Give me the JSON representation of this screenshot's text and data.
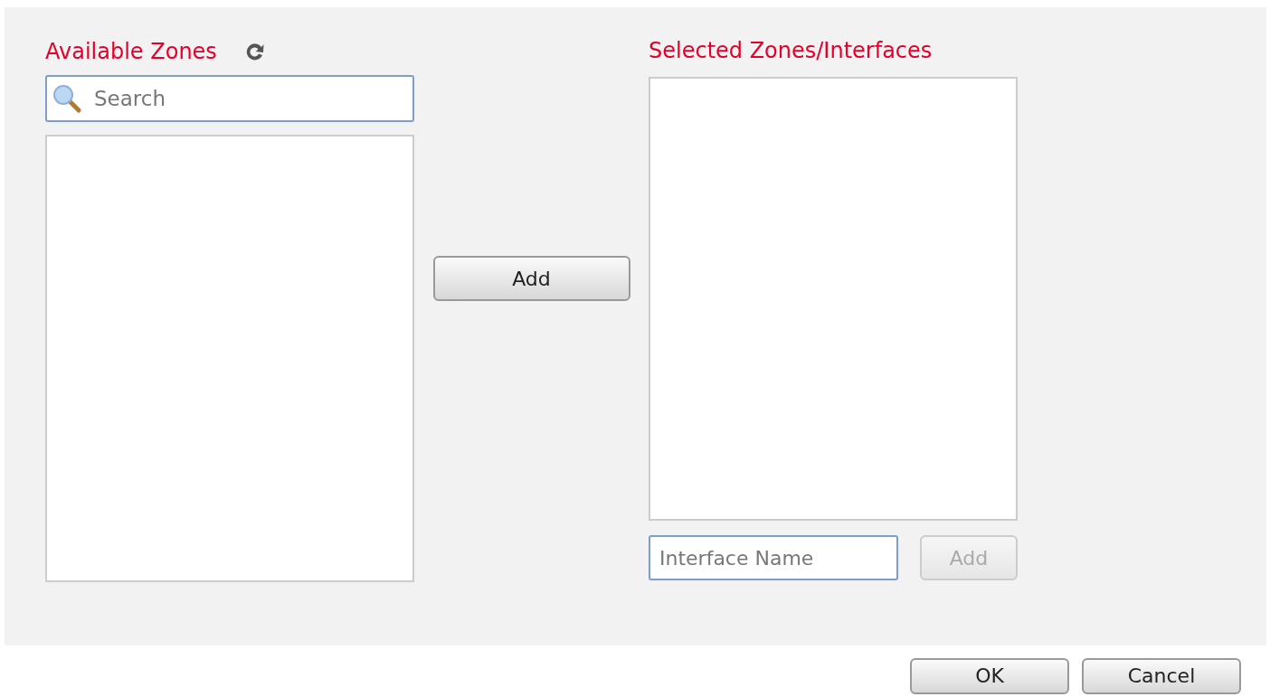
{
  "available": {
    "title": "Available Zones",
    "search": {
      "placeholder": "Search"
    }
  },
  "add_button": {
    "label": "Add",
    "disabled": false
  },
  "selected": {
    "title": "Selected Zones/Interfaces",
    "interface_field": {
      "placeholder": "Interface Name"
    },
    "add_button": {
      "label": "Add",
      "disabled": true
    }
  },
  "footer_buttons": [
    "OK",
    "Cancel"
  ]
}
